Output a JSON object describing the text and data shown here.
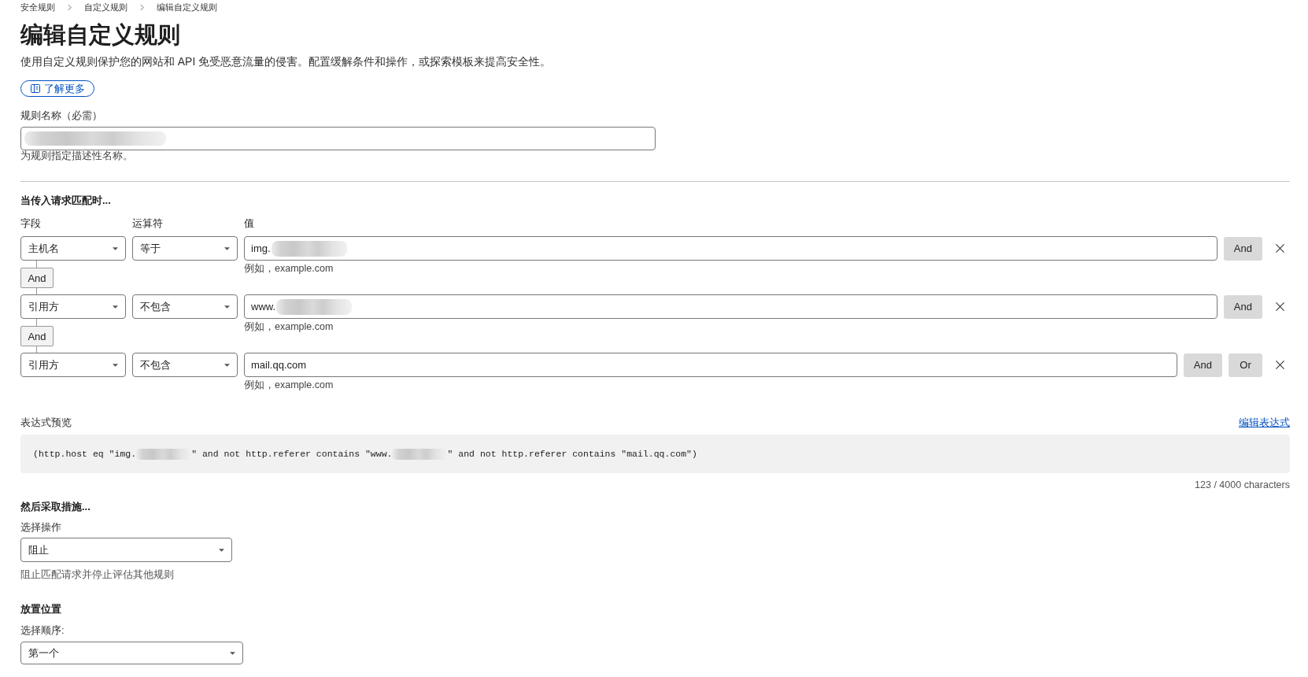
{
  "breadcrumb": [
    "安全规则",
    "自定义规则",
    "编辑自定义规则"
  ],
  "title": "编辑自定义规则",
  "description": "使用自定义规则保护您的网站和 API 免受恶意流量的侵害。配置缓解条件和操作，或探索模板来提高安全性。",
  "learn_more_button": "了解更多",
  "name_field": {
    "label": "规则名称（必需）",
    "value_redacted": true,
    "hint": "为规则指定描述性名称。"
  },
  "match_section": {
    "title": "当传入请求匹配时...",
    "columns": [
      "字段",
      "运算符",
      "值"
    ]
  },
  "conditions": [
    {
      "field": "主机名",
      "operator": "等于",
      "value": "img.",
      "value_redacted": true,
      "hint": "例如，example.com",
      "actions": [
        "And"
      ]
    },
    {
      "joiner": "And",
      "field": "引用方",
      "operator": "不包含",
      "value": "www.",
      "value_redacted": true,
      "hint": "例如，example.com",
      "actions": [
        "And"
      ]
    },
    {
      "joiner": "And",
      "field": "引用方",
      "operator": "不包含",
      "value": "mail.qq.com",
      "hint": "例如，example.com",
      "actions": [
        "And",
        "Or"
      ]
    }
  ],
  "expression_preview": {
    "label": "表达式预览",
    "edit_link": "编辑表达式",
    "segments": [
      {
        "kind": "text",
        "text": "(http.host eq \"img."
      },
      {
        "kind": "redacted"
      },
      {
        "kind": "text",
        "text": "\" and not http.referer contains \"www."
      },
      {
        "kind": "redacted"
      },
      {
        "kind": "text",
        "text": "\" and not http.referer contains \"mail.qq.com\")"
      }
    ],
    "char_count": "123 / 4000 characters"
  },
  "action_section": {
    "title": "然后采取措施...",
    "label": "选择操作",
    "value": "阻止",
    "hint": "阻止匹配请求并停止评估其他规则"
  },
  "placement_section": {
    "title": "放置位置",
    "label": "选择顺序:",
    "value": "第一个"
  }
}
